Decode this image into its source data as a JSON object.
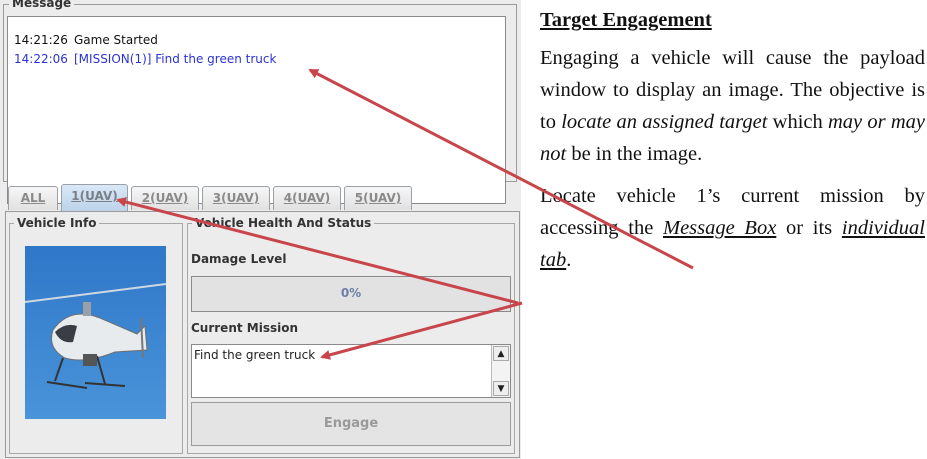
{
  "message_panel": {
    "title": "Message",
    "messages": [
      {
        "time": "14:21:26",
        "text": "Game Started",
        "color": "#111111"
      },
      {
        "time": "14:22:06",
        "text": "[MISSION(1)] Find the green truck",
        "color": "#2c33d4"
      }
    ]
  },
  "tabs": [
    {
      "label": "ALL",
      "active": false
    },
    {
      "label": "1(UAV)",
      "active": true
    },
    {
      "label": "2(UAV)",
      "active": false
    },
    {
      "label": "3(UAV)",
      "active": false
    },
    {
      "label": "4(UAV)",
      "active": false
    },
    {
      "label": "5(UAV)",
      "active": false
    }
  ],
  "vehicle_info": {
    "title": "Vehicle Info"
  },
  "vehicle_health": {
    "title": "Vehicle Health And Status",
    "damage_label": "Damage Level",
    "damage_value": "0%",
    "mission_label": "Current Mission",
    "mission_text": "Find the green truck",
    "engage_label": "Engage"
  },
  "instructions": {
    "heading": "Target Engagement",
    "p1_a": "Engaging a vehicle will cause the payload window to display an image. The objective is to ",
    "p1_em1": "locate an assigned target",
    "p1_b": " which ",
    "p1_em2": "may or may not",
    "p1_c": " be in the image.",
    "p2_a": "Locate vehicle 1’s current mission by accessing the ",
    "p2_link1": "Message Box",
    "p2_b": " or its ",
    "p2_link2": "individual tab",
    "p2_c": "."
  },
  "colors": {
    "arrow": "#c8464b",
    "highlight_text": "#2c33d4"
  }
}
